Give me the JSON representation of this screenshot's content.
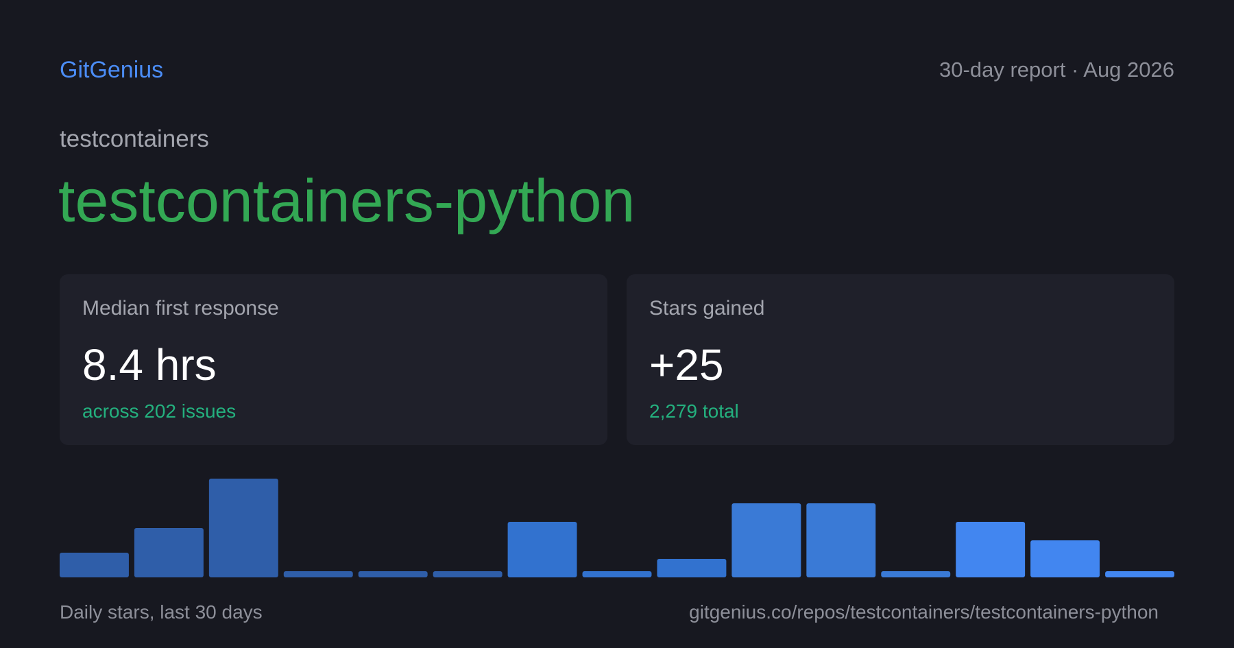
{
  "header": {
    "brand": "GitGenius",
    "report_meta": "30-day report · Aug 2026"
  },
  "repo": {
    "owner": "testcontainers",
    "name": "testcontainers-python"
  },
  "cards": [
    {
      "label": "Median first response",
      "value": "8.4 hrs",
      "sub": "across 202 issues"
    },
    {
      "label": "Stars gained",
      "value": "+25",
      "sub": "2,279 total"
    }
  ],
  "chart_data": {
    "type": "bar",
    "values": [
      2,
      4,
      8,
      0.5,
      0.5,
      0.5,
      4.5,
      0.5,
      1.5,
      6,
      6,
      0.5,
      4.5,
      3,
      0.5
    ],
    "ylim": [
      0,
      8
    ],
    "colors": [
      "#2f5ea9",
      "#2f5ea9",
      "#2f5ea9",
      "#2f5ea9",
      "#2f5ea9",
      "#2f5ea9",
      "#3272cf",
      "#3272cf",
      "#3272cf",
      "#3a7ad6",
      "#3a7ad6",
      "#3a7ad6",
      "#4286f0",
      "#4286f0",
      "#4286f0"
    ]
  },
  "footer": {
    "caption": "Daily stars, last 30 days",
    "url": "gitgenius.co/repos/testcontainers/testcontainers-python"
  }
}
